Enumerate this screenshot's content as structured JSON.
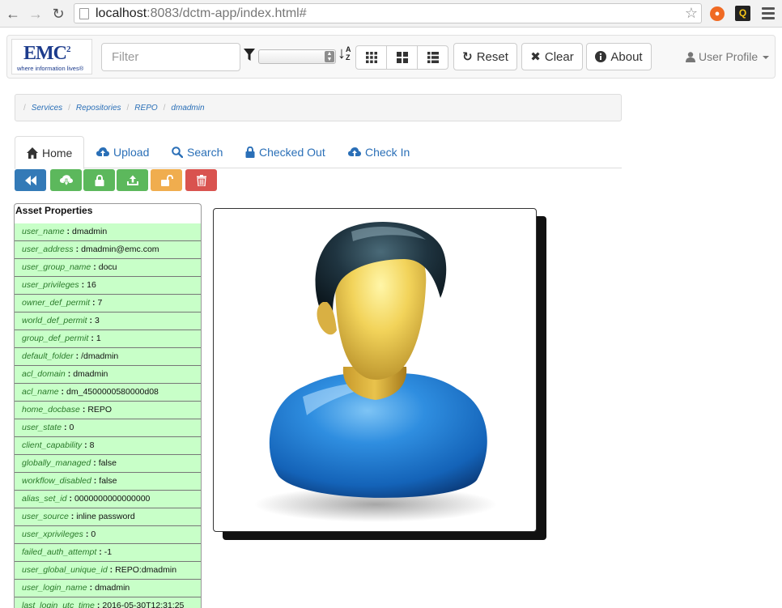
{
  "browser": {
    "url_host": "localhost",
    "url_rest": ":8083/dctm-app/index.html#"
  },
  "header": {
    "logo_text": "EMC",
    "logo_sup": "2",
    "logo_tagline": "where information lives®",
    "filter_placeholder": "Filter",
    "reset_label": "Reset",
    "clear_label": "Clear",
    "about_label": "About",
    "profile_label": "User Profile"
  },
  "breadcrumb": [
    "Services",
    "Repositories",
    "REPO",
    "dmadmin"
  ],
  "tabs": [
    {
      "label": "Home",
      "icon": "home-icon"
    },
    {
      "label": "Upload",
      "icon": "cloud-upload-icon"
    },
    {
      "label": "Search",
      "icon": "search-icon"
    },
    {
      "label": "Checked Out",
      "icon": "lock-icon"
    },
    {
      "label": "Check In",
      "icon": "cloud-upload-icon"
    }
  ],
  "actions": [
    {
      "name": "back",
      "icon": "backward-icon",
      "color": "#337ab7"
    },
    {
      "name": "download",
      "icon": "cloud-download-icon",
      "color": "#5cb85c"
    },
    {
      "name": "lock",
      "icon": "lock-icon",
      "color": "#5cb85c"
    },
    {
      "name": "export",
      "icon": "export-icon",
      "color": "#5cb85c"
    },
    {
      "name": "unlock",
      "icon": "unlock-icon",
      "color": "#f0ad4e"
    },
    {
      "name": "delete",
      "icon": "trash-icon",
      "color": "#d9534f"
    }
  ],
  "properties": {
    "title": "Asset Properties",
    "items": [
      {
        "key": "user_name",
        "value": "dmadmin"
      },
      {
        "key": "user_address",
        "value": "dmadmin@emc.com"
      },
      {
        "key": "user_group_name",
        "value": "docu"
      },
      {
        "key": "user_privileges",
        "value": "16"
      },
      {
        "key": "owner_def_permit",
        "value": "7"
      },
      {
        "key": "world_def_permit",
        "value": "3"
      },
      {
        "key": "group_def_permit",
        "value": "1"
      },
      {
        "key": "default_folder",
        "value": "/dmadmin"
      },
      {
        "key": "acl_domain",
        "value": "dmadmin"
      },
      {
        "key": "acl_name",
        "value": "dm_4500000580000d08"
      },
      {
        "key": "home_docbase",
        "value": "REPO"
      },
      {
        "key": "user_state",
        "value": "0"
      },
      {
        "key": "client_capability",
        "value": "8"
      },
      {
        "key": "globally_managed",
        "value": "false"
      },
      {
        "key": "workflow_disabled",
        "value": "false"
      },
      {
        "key": "alias_set_id",
        "value": "0000000000000000"
      },
      {
        "key": "user_source",
        "value": "inline password"
      },
      {
        "key": "user_xprivileges",
        "value": "0"
      },
      {
        "key": "failed_auth_attempt",
        "value": "-1"
      },
      {
        "key": "user_global_unique_id",
        "value": "REPO:dmadmin"
      },
      {
        "key": "user_login_name",
        "value": "dmadmin"
      },
      {
        "key": "last_login_utc_time",
        "value": "2016-05-30T12:31:25"
      }
    ]
  }
}
